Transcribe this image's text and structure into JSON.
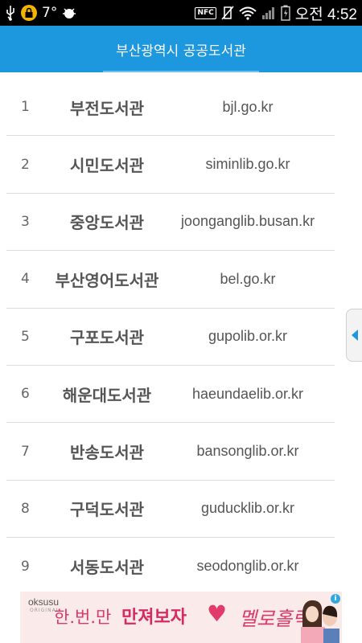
{
  "statusbar": {
    "icons_left": [
      "usb-icon",
      "lock-icon",
      "weather-icon",
      "android-debug-icon"
    ],
    "temperature": "7°",
    "icons_right": [
      "nfc-icon",
      "vibrate-icon",
      "wifi-icon",
      "signal-icon",
      "battery-icon"
    ],
    "nfc_label": "NFC",
    "time": "오전 4:52"
  },
  "appbar": {
    "title": "부산광역시 공공도서관"
  },
  "libraries": [
    {
      "num": "1",
      "name": "부전도서관",
      "url": "bjl.go.kr"
    },
    {
      "num": "2",
      "name": "시민도서관",
      "url": "siminlib.go.kr"
    },
    {
      "num": "3",
      "name": "중앙도서관",
      "url": "joonganglib.busan.kr"
    },
    {
      "num": "4",
      "name": "부산영어도서관",
      "url": "bel.go.kr"
    },
    {
      "num": "5",
      "name": "구포도서관",
      "url": "gupolib.or.kr"
    },
    {
      "num": "6",
      "name": "해운대도서관",
      "url": "haeundaelib.or.kr"
    },
    {
      "num": "7",
      "name": "반송도서관",
      "url": "bansonglib.or.kr"
    },
    {
      "num": "8",
      "name": "구덕도서관",
      "url": "guducklib.or.kr"
    },
    {
      "num": "9",
      "name": "서동도서관",
      "url": "seodonglib.or.kr"
    }
  ],
  "ad": {
    "brand": "oksusu",
    "brand_sub": "ORIGINAL",
    "text1": "한.번.만",
    "text2": "만져보자",
    "text3": "멜로홀릭",
    "info_label": "i",
    "close_label": "✕"
  },
  "colors": {
    "appbar": "#1d97de",
    "statusbar": "#000000",
    "ad_bg": "#fbeaea",
    "ad_accent": "#d62b62"
  }
}
